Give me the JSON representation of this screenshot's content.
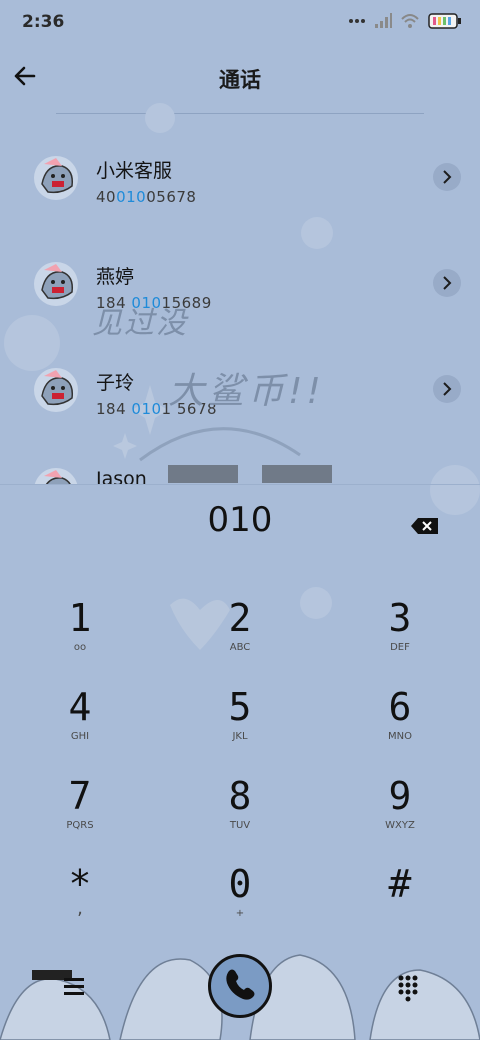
{
  "status": {
    "time": "2:36"
  },
  "header": {
    "title": "通话"
  },
  "contacts": [
    {
      "name": "小米客服",
      "pre": "40",
      "hl": "010",
      "post": "05678"
    },
    {
      "name": "燕婷",
      "pre": "184 ",
      "hl": "010",
      "post": "15689"
    },
    {
      "name": "子玲",
      "pre": "184 ",
      "hl": "010",
      "post": "1 5678"
    },
    {
      "name": "Jason",
      "pre": "",
      "hl": "",
      "post": ""
    }
  ],
  "watermark": {
    "line1": "见过没",
    "line2": "大鲨币!!"
  },
  "dialer": {
    "digits": "010",
    "keys": [
      {
        "d": "1",
        "l": "oo"
      },
      {
        "d": "2",
        "l": "ABC"
      },
      {
        "d": "3",
        "l": "DEF"
      },
      {
        "d": "4",
        "l": "GHI"
      },
      {
        "d": "5",
        "l": "JKL"
      },
      {
        "d": "6",
        "l": "MNO"
      },
      {
        "d": "7",
        "l": "PQRS"
      },
      {
        "d": "8",
        "l": "TUV"
      },
      {
        "d": "9",
        "l": "WXYZ"
      },
      {
        "d": "*",
        "l": ","
      },
      {
        "d": "0",
        "l": "+"
      },
      {
        "d": "#",
        "l": ""
      }
    ]
  },
  "icons": {
    "back": "arrow-left-icon",
    "chevron": "chevron-right-icon",
    "backspace": "backspace-icon",
    "menu": "menu-icon",
    "call": "phone-icon",
    "keypad": "keypad-icon"
  },
  "colors": {
    "background": "#a9bcd8",
    "highlight": "#1f8bd9",
    "call_button": "#7b9bc4"
  }
}
